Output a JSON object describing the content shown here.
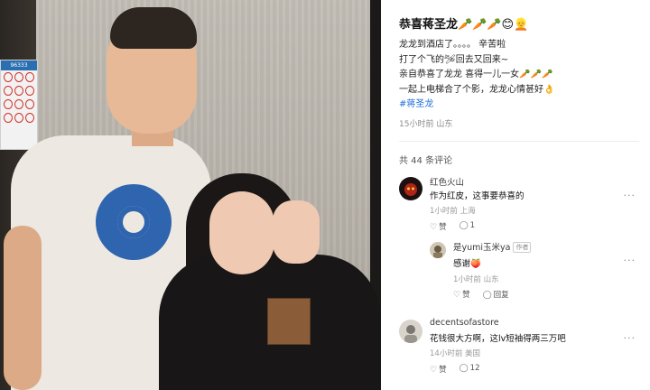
{
  "post": {
    "title": "恭喜蒋圣龙🥕🥕🥕😊👱",
    "lines": [
      "龙龙到酒店了。。。。 辛苦啦",
      "打了个飞的🛩回去又回来~",
      "亲自恭喜了龙龙 喜得一儿一女🥕🥕🥕",
      "一起上电梯合了个影，龙龙心情甚好👌"
    ],
    "hashtag": "#蒋圣龙",
    "meta": "15小时前 山东",
    "more": "···"
  },
  "photo": {
    "notice_number": "96333"
  },
  "comments_header": "共 44 条评论",
  "comments": [
    {
      "name": "红色火山",
      "text": "作为红皮，这事要恭喜的",
      "meta": "1小时前 上海",
      "like": "赞",
      "reply_count": "1",
      "more": "···"
    },
    {
      "name": "是yumi玉米ya",
      "badge": "作者",
      "text": "感谢🍑",
      "meta": "1小时前 山东",
      "like": "赞",
      "reply": "回复",
      "more": "···"
    },
    {
      "name": "decentsofastore",
      "text": "花钱很大方啊，这lv短袖得两三万吧",
      "meta": "14小时前 美国",
      "like": "赞",
      "reply_count": "12",
      "more": "···"
    }
  ],
  "colors": {
    "link": "#1e6fd9",
    "text": "#1a1a1a",
    "muted": "#8c8c8c"
  }
}
